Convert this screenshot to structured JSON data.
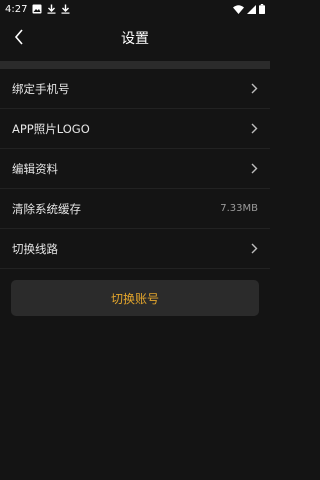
{
  "status": {
    "time": "4:27",
    "left_icons": [
      "image-icon",
      "download-icon",
      "download-icon"
    ],
    "right_icons": [
      "wifi-icon",
      "signal-icon",
      "battery-icon"
    ]
  },
  "header": {
    "title": "设置",
    "back_icon": "chevron-left-icon"
  },
  "menu": {
    "items": [
      {
        "label": "绑定手机号",
        "icon": "chevron-right-icon"
      },
      {
        "label": "APP照片LOGO",
        "icon": "chevron-right-icon"
      },
      {
        "label": "编辑资料",
        "icon": "chevron-right-icon"
      },
      {
        "label": "清除系统缓存",
        "value": "7.33MB"
      },
      {
        "label": "切换线路",
        "icon": "chevron-right-icon"
      }
    ]
  },
  "action": {
    "switch_account_label": "切换账号"
  },
  "colors": {
    "background": "#141414",
    "band": "#2b2b2b",
    "accent": "#e3a52c",
    "text": "#e6e6e6",
    "muted": "#9a9a9a"
  }
}
